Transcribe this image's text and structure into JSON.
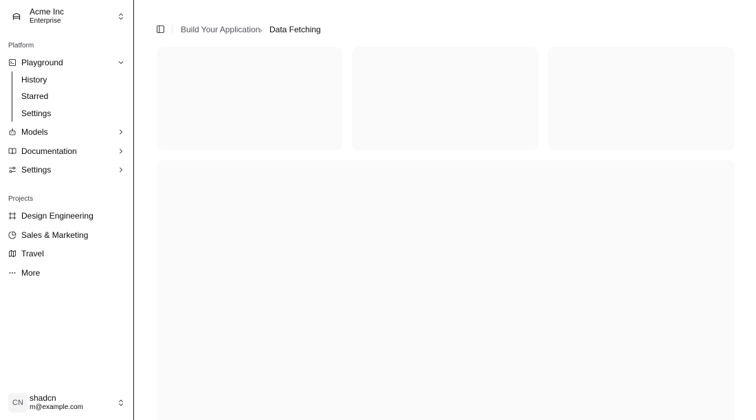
{
  "team": {
    "name": "Acme Inc",
    "plan": "Enterprise"
  },
  "platform": {
    "label": "Platform",
    "items": [
      {
        "label": "Playground",
        "icon": "terminal-icon"
      },
      {
        "label": "Models",
        "icon": "bot-icon"
      },
      {
        "label": "Documentation",
        "icon": "book-icon"
      },
      {
        "label": "Settings",
        "icon": "settings-sliders-icon"
      }
    ],
    "playground_sub": [
      "History",
      "Starred",
      "Settings"
    ]
  },
  "projects": {
    "label": "Projects",
    "items": [
      {
        "label": "Design Engineering",
        "icon": "frame-icon"
      },
      {
        "label": "Sales & Marketing",
        "icon": "pie-chart-icon"
      },
      {
        "label": "Travel",
        "icon": "map-icon"
      },
      {
        "label": "More",
        "icon": "more-horizontal-icon"
      }
    ]
  },
  "user": {
    "initials": "CN",
    "name": "shadcn",
    "email": "m@example.com"
  },
  "breadcrumb": {
    "parent": "Build Your Application",
    "current": "Data Fetching"
  },
  "colors": {
    "card_bg": "#fafafa",
    "sidebar_border": "#1f1f1f",
    "text": "#0a0a0a"
  }
}
